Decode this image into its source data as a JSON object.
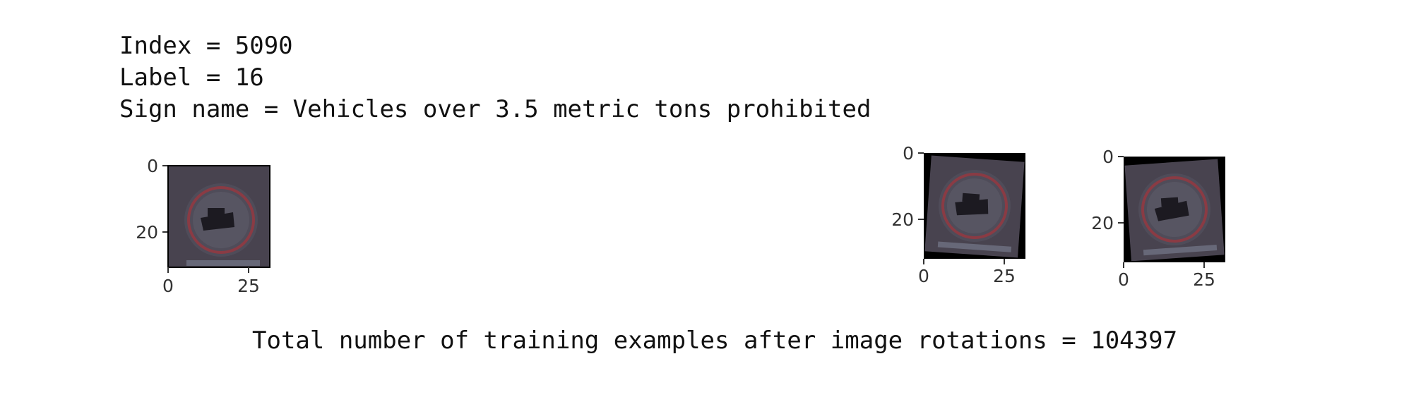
{
  "cell_output": {
    "index_line": "Index = 5090",
    "label_line": "Label = 16",
    "sign_name_line": "Sign name = Vehicles over 3.5 metric tons prohibited",
    "total_line": "Total number of training examples after image rotations = 104397"
  },
  "plots": [
    {
      "name": "original-image",
      "y_ticks": [
        "0",
        "20"
      ],
      "x_ticks": [
        "0",
        "25"
      ],
      "rotation_deg": 0
    },
    {
      "name": "rotated-image-1",
      "y_ticks": [
        "0",
        "20"
      ],
      "x_ticks": [
        "0",
        "25"
      ],
      "rotation_deg": 4
    },
    {
      "name": "rotated-image-2",
      "y_ticks": [
        "0",
        "20"
      ],
      "x_ticks": [
        "0",
        "25"
      ],
      "rotation_deg": -4
    }
  ],
  "colors": {
    "sign_background": "#48434f",
    "sign_ring": "#8a3b44",
    "sign_face": "#575562",
    "truck_silhouette": "#1c1a21",
    "frame_border": "#000000"
  }
}
